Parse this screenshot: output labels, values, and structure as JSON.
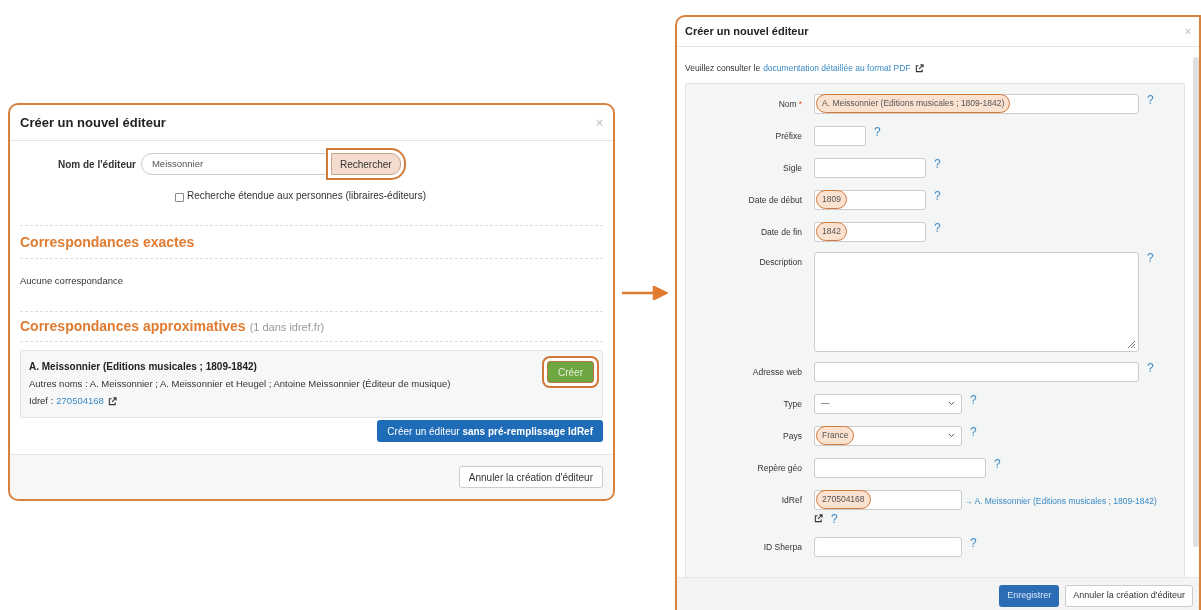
{
  "left_dialog": {
    "title": "Créer un nouvel éditeur",
    "close": "×",
    "search": {
      "label": "Nom de l'éditeur",
      "value": "Meissonnier",
      "button": "Rechercher",
      "button_highlighted": true
    },
    "extended_search": {
      "label": "Recherche étendue aux personnes (libraires-éditeurs)",
      "checked": false
    },
    "exact": {
      "heading": "Correspondances exactes",
      "empty": "Aucune correspondance"
    },
    "approx": {
      "heading": "Correspondances approximatives",
      "count": "(1 dans idref.fr)",
      "results": [
        {
          "name": "A. Meissonnier (Editions musicales ; 1809-1842)",
          "other_names": "Autres noms : A. Meissonnier ; A. Meissonnier et Heugel ; Antoine Meissonnier (Éditeur de musique)",
          "idref_label": "Idref :",
          "idref": "270504168",
          "button": "Créer",
          "button_highlighted": true
        }
      ]
    },
    "create_button": "Créer un éditeur **sans pré-remplissage IdRef**",
    "cancel": "Annuler la création d'éditeur"
  },
  "right_dialog": {
    "title": "Créer un nouvel éditeur",
    "close": "×",
    "intro": "Veuillez consulter le",
    "intro_link": "documentation détaillée au format PDF",
    "fields": [
      {
        "label": "Nom",
        "required_mark": "*",
        "kind": "input",
        "value": "A. Meissonnier (Editions musicales ; 1809-1842)",
        "highlighted": true,
        "help": "?"
      },
      {
        "label": "Préfixe",
        "kind": "input",
        "highlighted": false,
        "help": "?"
      },
      {
        "label": "Sigle",
        "kind": "input",
        "highlighted": false,
        "help": "?"
      },
      {
        "label": "Date de début",
        "kind": "input",
        "value": "1809",
        "highlighted": true,
        "help": "?"
      },
      {
        "label": "Date de fin",
        "kind": "input",
        "value": "1842",
        "highlighted": true,
        "help": "?"
      },
      {
        "label": "Description",
        "kind": "textarea",
        "highlighted": false,
        "help": "?"
      },
      {
        "label": "Adresse web",
        "kind": "input",
        "highlighted": false,
        "help": "?"
      },
      {
        "label": "Type",
        "kind": "select",
        "value": "—",
        "highlighted": false,
        "help": "?"
      },
      {
        "label": "Pays",
        "kind": "select",
        "value": "France",
        "highlighted": true,
        "help": "?"
      },
      {
        "label": "Repère géo",
        "kind": "input",
        "highlighted": false,
        "help": "?"
      },
      {
        "label": "IdRef",
        "kind": "idref",
        "value": "270504168",
        "highlighted": true,
        "link": "→ A. Meissonnier (Editions musicales ; 1809-1842)",
        "help": "?"
      },
      {
        "label": "ID Sherpa",
        "kind": "input",
        "highlighted": false,
        "help": "?"
      }
    ],
    "save": "Enregistrer",
    "cancel": "Annuler la création d'éditeur"
  }
}
